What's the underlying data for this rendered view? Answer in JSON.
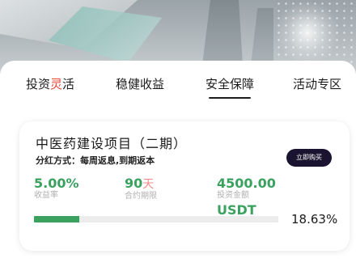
{
  "tabs": [
    {
      "label_prefix": "投资",
      "label_highlight": "灵",
      "label_suffix": "活",
      "active": false
    },
    {
      "label": "稳健收益",
      "active": false
    },
    {
      "label": "安全保障",
      "active": true
    },
    {
      "label": "活动专区",
      "active": false
    }
  ],
  "product": {
    "title": "中医药建设项目（二期）",
    "subtitle": "分红方式：每周返息,到期返本",
    "buy_label": "立即购买",
    "rate": {
      "value": "5.00%",
      "label": "收益率"
    },
    "term": {
      "value": "90",
      "unit": "天",
      "label": "合约期限"
    },
    "amount": {
      "value": "4500.00",
      "label": "投资金额",
      "currency": "USDT"
    },
    "progress": {
      "percent_text": "18.63%",
      "fill_fraction": 0.1863
    }
  },
  "colors": {
    "accent_green": "#3aa15f",
    "tab_highlight": "#e8453c",
    "buy_button_bg": "#1b1430"
  }
}
